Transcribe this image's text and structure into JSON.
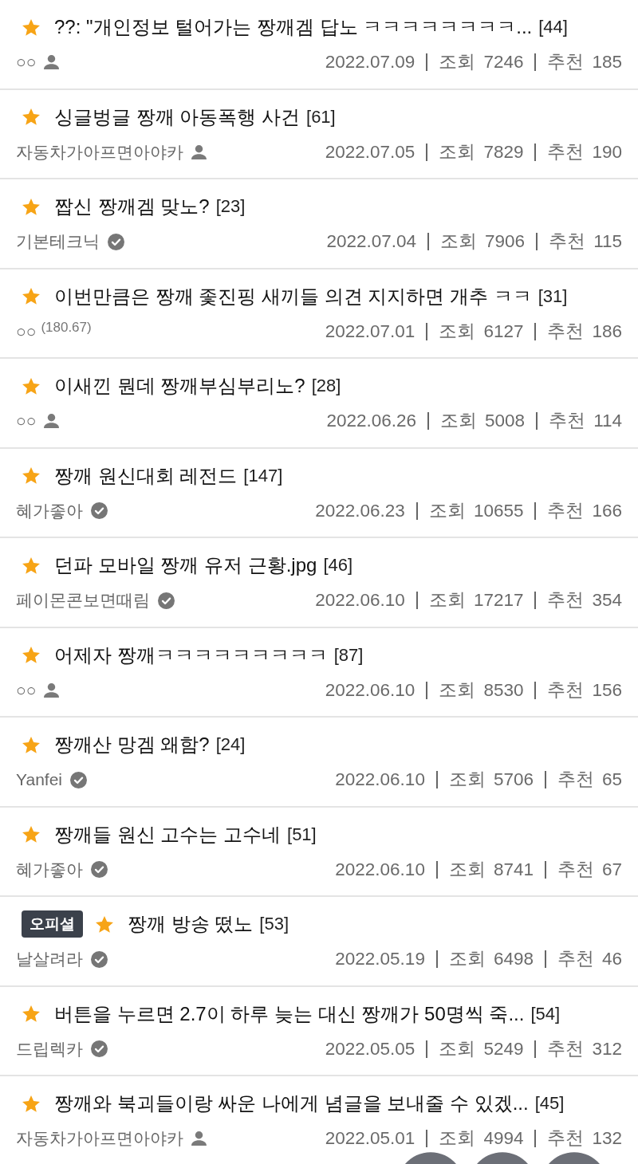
{
  "posts": [
    {
      "title": "??: \"개인정보 털어가는 짱깨겜 답노 ㅋㅋㅋㅋㅋㅋㅋㅋ...",
      "comments": "[44]",
      "author": {
        "kind": "guest",
        "name": "○○"
      },
      "date": "2022.07.09",
      "views": {
        "label": "조회",
        "value": "7246"
      },
      "likes": {
        "label": "추천",
        "value": "185"
      }
    },
    {
      "title": "싱글벙글 짱깨 아동폭행 사건",
      "comments": "[61]",
      "author": {
        "kind": "guest",
        "name": "자동차가아프면아야카"
      },
      "date": "2022.07.05",
      "views": {
        "label": "조회",
        "value": "7829"
      },
      "likes": {
        "label": "추천",
        "value": "190"
      }
    },
    {
      "title": "짭신 짱깨겜 맞노?",
      "comments": "[23]",
      "author": {
        "kind": "verified",
        "name": "기본테크닉"
      },
      "date": "2022.07.04",
      "views": {
        "label": "조회",
        "value": "7906"
      },
      "likes": {
        "label": "추천",
        "value": "115"
      }
    },
    {
      "title": "이번만큼은 짱깨 좇진핑 새끼들 의견 지지하면 개추 ㅋㅋ",
      "comments": "[31]",
      "author": {
        "kind": "ip",
        "name": "○○",
        "ip": "(180.67)"
      },
      "date": "2022.07.01",
      "views": {
        "label": "조회",
        "value": "6127"
      },
      "likes": {
        "label": "추천",
        "value": "186"
      }
    },
    {
      "title": "이새낀 뭔데 짱깨부심부리노?",
      "comments": "[28]",
      "author": {
        "kind": "guest",
        "name": "○○"
      },
      "date": "2022.06.26",
      "views": {
        "label": "조회",
        "value": "5008"
      },
      "likes": {
        "label": "추천",
        "value": "114"
      }
    },
    {
      "title": "짱깨 원신대회 레전드",
      "comments": "[147]",
      "author": {
        "kind": "verified",
        "name": "혜가좋아"
      },
      "date": "2022.06.23",
      "views": {
        "label": "조회",
        "value": "10655"
      },
      "likes": {
        "label": "추천",
        "value": "166"
      }
    },
    {
      "title": "던파 모바일 짱깨 유저 근황.jpg",
      "comments": "[46]",
      "author": {
        "kind": "verified",
        "name": "페이몬콘보면때림"
      },
      "date": "2022.06.10",
      "views": {
        "label": "조회",
        "value": "17217"
      },
      "likes": {
        "label": "추천",
        "value": "354"
      }
    },
    {
      "title": "어제자 짱깨ㅋㅋㅋㅋㅋㅋㅋㅋㅋ",
      "comments": "[87]",
      "author": {
        "kind": "guest",
        "name": "○○"
      },
      "date": "2022.06.10",
      "views": {
        "label": "조회",
        "value": "8530"
      },
      "likes": {
        "label": "추천",
        "value": "156"
      }
    },
    {
      "title": "짱깨산 망겜 왜함?",
      "comments": "[24]",
      "author": {
        "kind": "verified",
        "name": "Yanfei"
      },
      "date": "2022.06.10",
      "views": {
        "label": "조회",
        "value": "5706"
      },
      "likes": {
        "label": "추천",
        "value": "65"
      }
    },
    {
      "title": "짱깨들 원신 고수는 고수네",
      "comments": "[51]",
      "author": {
        "kind": "verified",
        "name": "혜가좋아"
      },
      "date": "2022.06.10",
      "views": {
        "label": "조회",
        "value": "8741"
      },
      "likes": {
        "label": "추천",
        "value": "67"
      }
    },
    {
      "tag": "오피셜",
      "title": "짱깨 방송 떴노",
      "comments": "[53]",
      "author": {
        "kind": "verified",
        "name": "날살려라"
      },
      "date": "2022.05.19",
      "views": {
        "label": "조회",
        "value": "6498"
      },
      "likes": {
        "label": "추천",
        "value": "46"
      }
    },
    {
      "title": "버튼을 누르면 2.7이 하루 늦는 대신 짱깨가 50명씩 죽...",
      "comments": "[54]",
      "author": {
        "kind": "verified",
        "name": "드립렉카"
      },
      "date": "2022.05.05",
      "views": {
        "label": "조회",
        "value": "5249"
      },
      "likes": {
        "label": "추천",
        "value": "312"
      }
    },
    {
      "title": "짱깨와 북괴들이랑 싸운 나에게 념글을 보내줄 수 있겠...",
      "comments": "[45]",
      "author": {
        "kind": "guest",
        "name": "자동차가아프면아야카"
      },
      "date": "2022.05.01",
      "views": {
        "label": "조회",
        "value": "4994"
      },
      "likes": {
        "label": "추천",
        "value": "132"
      }
    }
  ]
}
